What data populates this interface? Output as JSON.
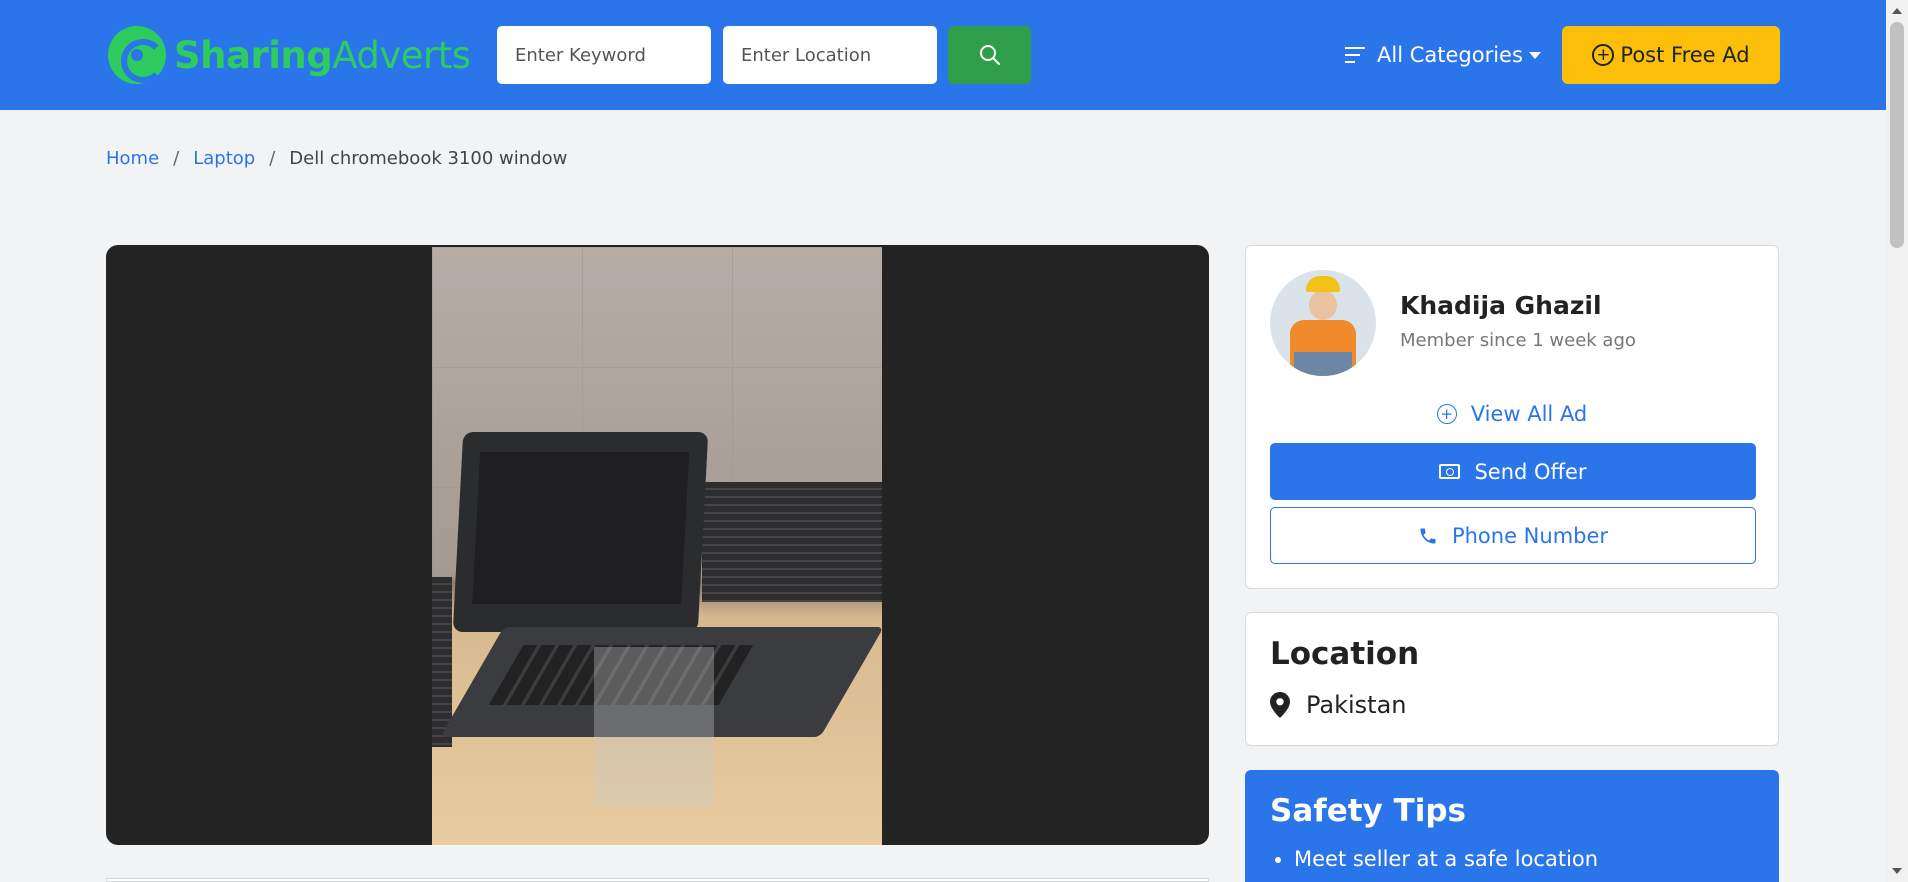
{
  "brand": {
    "name_bold": "Sharing",
    "name_light": "Adverts",
    "color": "#2ecc5e"
  },
  "header": {
    "keyword_placeholder": "Enter Keyword",
    "location_placeholder": "Enter Location",
    "categories_label": "All Categories",
    "post_ad_label": "Post Free Ad",
    "bg_color": "#2a75ea",
    "post_ad_color": "#fbbf0a"
  },
  "breadcrumb": {
    "home": "Home",
    "category": "Laptop",
    "current": "Dell chromebook 3100 window",
    "separator": "/"
  },
  "seller": {
    "name": "Khadija Ghazil",
    "member_since": "Member since 1 week ago",
    "view_all_label": "View All Ad",
    "send_offer_label": "Send Offer",
    "phone_label": "Phone Number"
  },
  "location": {
    "title": "Location",
    "value": "Pakistan"
  },
  "safety": {
    "title": "Safety Tips",
    "tips": [
      "Meet seller at a safe location"
    ]
  }
}
